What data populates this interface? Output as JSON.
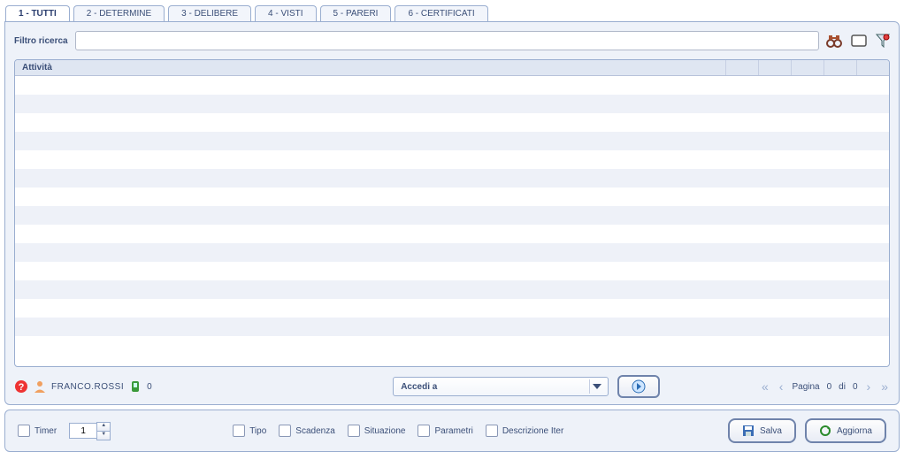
{
  "tabs": [
    {
      "label": "1 - TUTTI",
      "active": true
    },
    {
      "label": "2 - DETERMINE",
      "active": false
    },
    {
      "label": "3 - DELIBERE",
      "active": false
    },
    {
      "label": "4 - VISTI",
      "active": false
    },
    {
      "label": "5 - PARERI",
      "active": false
    },
    {
      "label": "6 - CERTIFICATI",
      "active": false
    }
  ],
  "filter": {
    "label": "Filtro ricerca",
    "value": "",
    "placeholder": ""
  },
  "grid": {
    "columns": {
      "activity": "Attività"
    },
    "row_count": 15
  },
  "status": {
    "user_name": "FRANCO.ROSSI",
    "counter": "0"
  },
  "accedi": {
    "label": "Accedi a"
  },
  "pager": {
    "prefix": "Pagina",
    "current": "0",
    "sep": "di",
    "total": "0"
  },
  "bottom": {
    "timer_label": "Timer",
    "timer_value": "1",
    "cb_tipo": "Tipo",
    "cb_scadenza": "Scadenza",
    "cb_situazione": "Situazione",
    "cb_parametri": "Parametri",
    "cb_descr_iter": "Descrizione Iter",
    "save": "Salva",
    "refresh": "Aggiorna"
  },
  "icons": {
    "binoculars": "search-binoculars-icon",
    "clear": "clear-icon",
    "funnel": "filter-funnel-icon",
    "help": "help-icon",
    "user": "user-icon",
    "phone": "phone-icon",
    "arrow": "go-arrow-icon",
    "floppy": "save-floppy-icon",
    "refresh": "refresh-icon"
  }
}
